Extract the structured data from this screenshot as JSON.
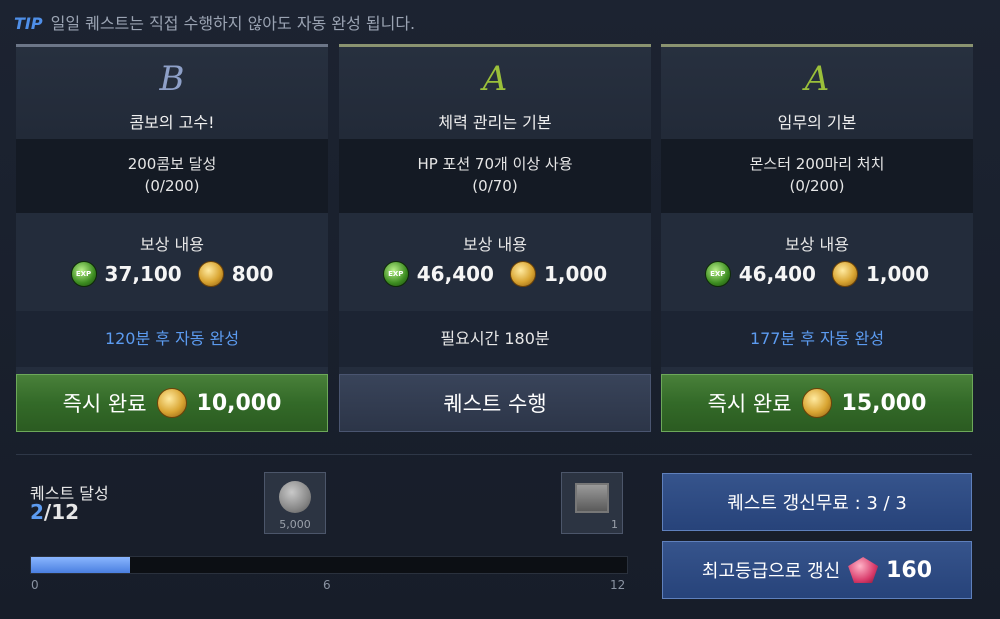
{
  "tip": {
    "tag": "TIP",
    "text": "일일 퀘스트는 직접 수행하지 않아도 자동 완성 됩니다."
  },
  "cards": [
    {
      "grade": "B",
      "title": "콤보의 고수!",
      "condition": "200콤보 달성",
      "progress": "(0/200)",
      "reward_label": "보상 내용",
      "exp": "37,100",
      "gold": "800",
      "status": "120분 후 자동 완성",
      "button_label": "즉시 완료",
      "button_amount": "10,000"
    },
    {
      "grade": "A",
      "title": "체력 관리는 기본",
      "condition": "HP 포션 70개 이상 사용",
      "progress": "(0/70)",
      "reward_label": "보상 내용",
      "exp": "46,400",
      "gold": "1,000",
      "status": "필요시간 180분",
      "button_label": "퀘스트 수행"
    },
    {
      "grade": "A",
      "title": "임무의 기본",
      "condition": "몬스터 200마리 처치",
      "progress": "(0/200)",
      "reward_label": "보상 내용",
      "exp": "46,400",
      "gold": "1,000",
      "status": "177분 후 자동 완성",
      "button_label": "즉시 완료",
      "button_amount": "15,000"
    }
  ],
  "exp_icon_text": "EXP",
  "quest_progress": {
    "label": "퀘스트 달성",
    "current": "2",
    "total": "/12",
    "fraction": 0.1667,
    "reward1_caption": "5,000",
    "reward2_caption": "1",
    "ticks": [
      "0",
      "6",
      "12"
    ]
  },
  "refresh_free": {
    "label": "퀘스트 갱신무료 : 3 / 3"
  },
  "refresh_top": {
    "label": "최고등급으로 갱신",
    "amount": "160"
  }
}
